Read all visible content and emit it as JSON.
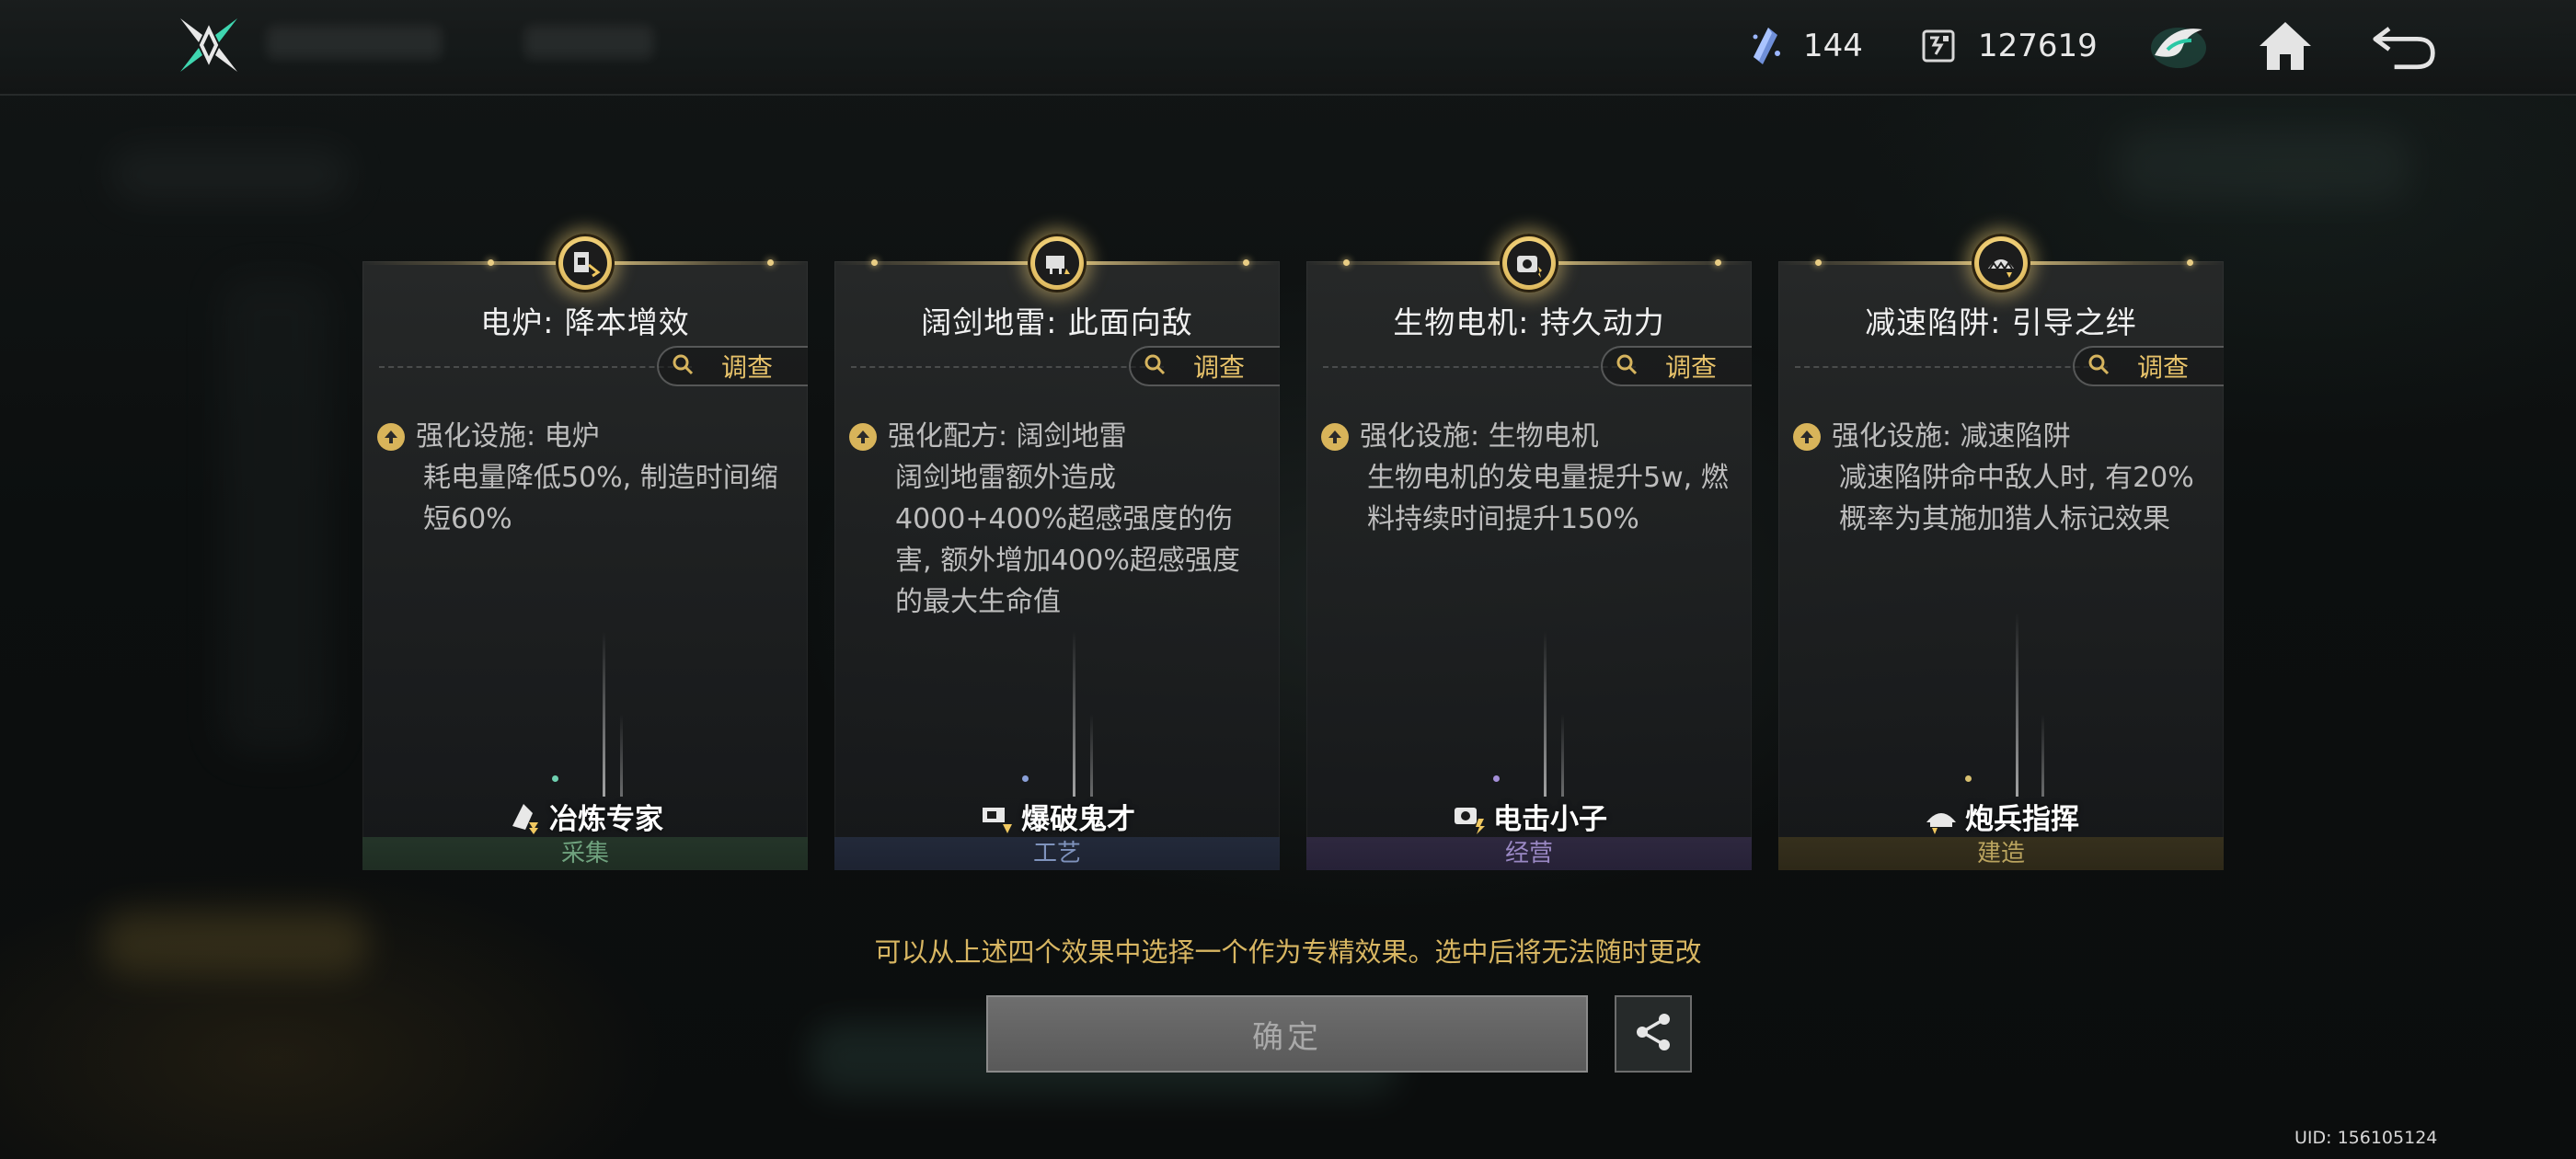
{
  "topbar": {
    "currencies": [
      {
        "icon": "crystal-shard-icon",
        "value": "144"
      },
      {
        "icon": "chip-icon",
        "value": "127619"
      }
    ],
    "icons": [
      "faction-emblem-icon",
      "home-icon",
      "back-icon"
    ]
  },
  "cards": [
    {
      "title": "电炉: 降本增效",
      "investigate_label": "调查",
      "line1": "强化设施: 电炉",
      "body": "耗电量降低50%, 制造时间缩短60%",
      "specialist": "冶炼专家",
      "category": "采集",
      "category_color": "#5b8a6a"
    },
    {
      "title": "阔剑地雷: 此面向敌",
      "investigate_label": "调查",
      "line1": "强化配方: 阔剑地雷",
      "body": "阔剑地雷额外造成4000+400%超感强度的伤害, 额外增加400%超感强度的最大生命值",
      "specialist": "爆破鬼才",
      "category": "工艺",
      "category_color": "#6a7c9c"
    },
    {
      "title": "生物电机: 持久动力",
      "investigate_label": "调查",
      "line1": "强化设施: 生物电机",
      "body": "生物电机的发电量提升5w, 燃料持续时间提升150%",
      "specialist": "电击小子",
      "category": "经营",
      "category_color": "#8b7bb0"
    },
    {
      "title": "减速陷阱: 引导之绊",
      "investigate_label": "调查",
      "line1": "强化设施: 减速陷阱",
      "body": "减速陷阱命中敌人时, 有20%概率为其施加猎人标记效果",
      "specialist": "炮兵指挥",
      "category": "建造",
      "category_color": "#a6924f"
    }
  ],
  "hint": "可以从上述四个效果中选择一个作为专精效果。选中后将无法随时更改",
  "confirm_label": "确定",
  "uid": "UID: 156105124",
  "colors": {
    "accent_gold": "#e7c26a",
    "hint": "#d8b662"
  }
}
